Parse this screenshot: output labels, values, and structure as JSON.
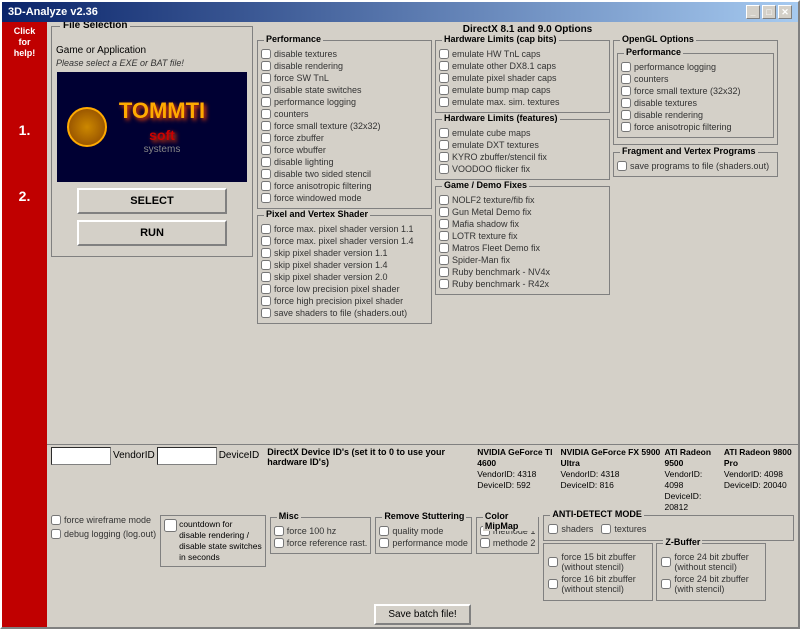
{
  "title": "3D-Analyze v2.36",
  "click_help": "Click\nfor\nhelp!",
  "steps": {
    "step1": "1.",
    "step2": "2."
  },
  "file_selection": {
    "title": "File Selection",
    "game_label": "Game or Application",
    "path_placeholder": "Please select a EXE or BAT file!",
    "select_btn": "SELECT",
    "run_btn": "RUN"
  },
  "performance": {
    "title": "Performance",
    "items": [
      "disable textures",
      "disable rendering",
      "force SW TnL",
      "disable state switches",
      "performance logging",
      "counters",
      "force small texture (32x32)",
      "force zbuffer",
      "force wbuffer",
      "disable lighting",
      "disable two sided stencil",
      "force anisotropic filtering",
      "force windowed mode"
    ]
  },
  "pixel_vertex_shader": {
    "title": "Pixel and Vertex Shader",
    "items": [
      "force max. pixel shader version 1.1",
      "force max. pixel shader version 1.4",
      "skip pixel shader version 1.1",
      "skip pixel shader version 1.4",
      "skip pixel shader version 2.0",
      "force low precision pixel shader",
      "force high precision pixel shader",
      "save shaders to file (shaders.out)"
    ]
  },
  "directx_options": {
    "title": "DirectX 8.1 and 9.0 Options"
  },
  "hardware_limits_cap": {
    "title": "Hardware Limits (cap bits)",
    "items": [
      "emulate HW TnL caps",
      "emulate other DX8.1 caps",
      "emulate pixel shader caps",
      "emulate bump map caps",
      "emulate max. sim. textures"
    ]
  },
  "hardware_limits_features": {
    "title": "Hardware Limits (features)",
    "items": [
      "emulate cube maps",
      "emulate DXT textures",
      "KYRO zbuffer/stencil fix",
      "VOODOO flicker fix"
    ]
  },
  "game_demo_fixes": {
    "title": "Game / Demo Fixes",
    "items": [
      "NOLF2 texture/fib fix",
      "Gun Metal Demo fix",
      "Mafia shadow fix",
      "LOTR texture fix",
      "Matros Fleet Demo fix",
      "Spider-Man fix",
      "Ruby benchmark - NV4x",
      "Ruby benchmark - R42x"
    ]
  },
  "opengl": {
    "title": "OpenGL Options",
    "performance": {
      "title": "Performance",
      "items": [
        "performance logging",
        "counters",
        "force small texture (32x32)",
        "disable textures",
        "disable rendering",
        "force anisotropic filtering"
      ]
    }
  },
  "fragment_vertex": {
    "title": "Fragment and Vertex Programs",
    "items": [
      "save programs to file (shaders.out)"
    ]
  },
  "device_ids": {
    "label": "DirectX Device ID's (set it to 0 to use your hardware ID's)",
    "vendor_label": "VendorID",
    "device_label": "DeviceID",
    "cards": [
      {
        "name": "NVIDIA GeForce TI 4600",
        "vendor_id": "4318",
        "device_id": "592"
      },
      {
        "name": "NVIDIA GeForce FX 5900 Ultra",
        "vendor_id": "4318",
        "device_id": "816"
      },
      {
        "name": "ATI Radeon 9500",
        "vendor_id": "4098",
        "device_id": "20812"
      },
      {
        "name": "ATI Radeon 9800 Pro",
        "vendor_id": "4098",
        "device_id": "20040"
      }
    ]
  },
  "misc": {
    "title": "Misc",
    "items": [
      "force wireframe mode",
      "debug logging (log.out)",
      "force 100 hz",
      "force reference rast."
    ],
    "remove_stuttering": {
      "title": "Remove Stuttering",
      "items": [
        "quality mode",
        "performance mode"
      ]
    },
    "color_mipmap": {
      "title": "Color MipMap",
      "items": [
        "methode 1",
        "methode 2"
      ]
    },
    "countdown": "countdown for\ndisable rendering /\ndisable state switches\nin seconds"
  },
  "anti_detect": {
    "title": "ANTI-DETECT MODE",
    "items": [
      "shaders",
      "textures"
    ]
  },
  "zbuffer": {
    "title": "Z-Buffer",
    "items": [
      "force 15 bit zbuffer\n(without stencil)",
      "force 16 bit zbuffer\n(without stencil)",
      "force 24 bit zbuffer\n(without stencil)",
      "force 24 bit zbuffer\n(with stencil)"
    ]
  },
  "force_15_zb": {
    "items": [
      "force 15 bit zbuffer\n(without stencil)",
      "force 16 bit zbuffer\n(without stencil)"
    ]
  },
  "save_batch": "Save batch file!"
}
